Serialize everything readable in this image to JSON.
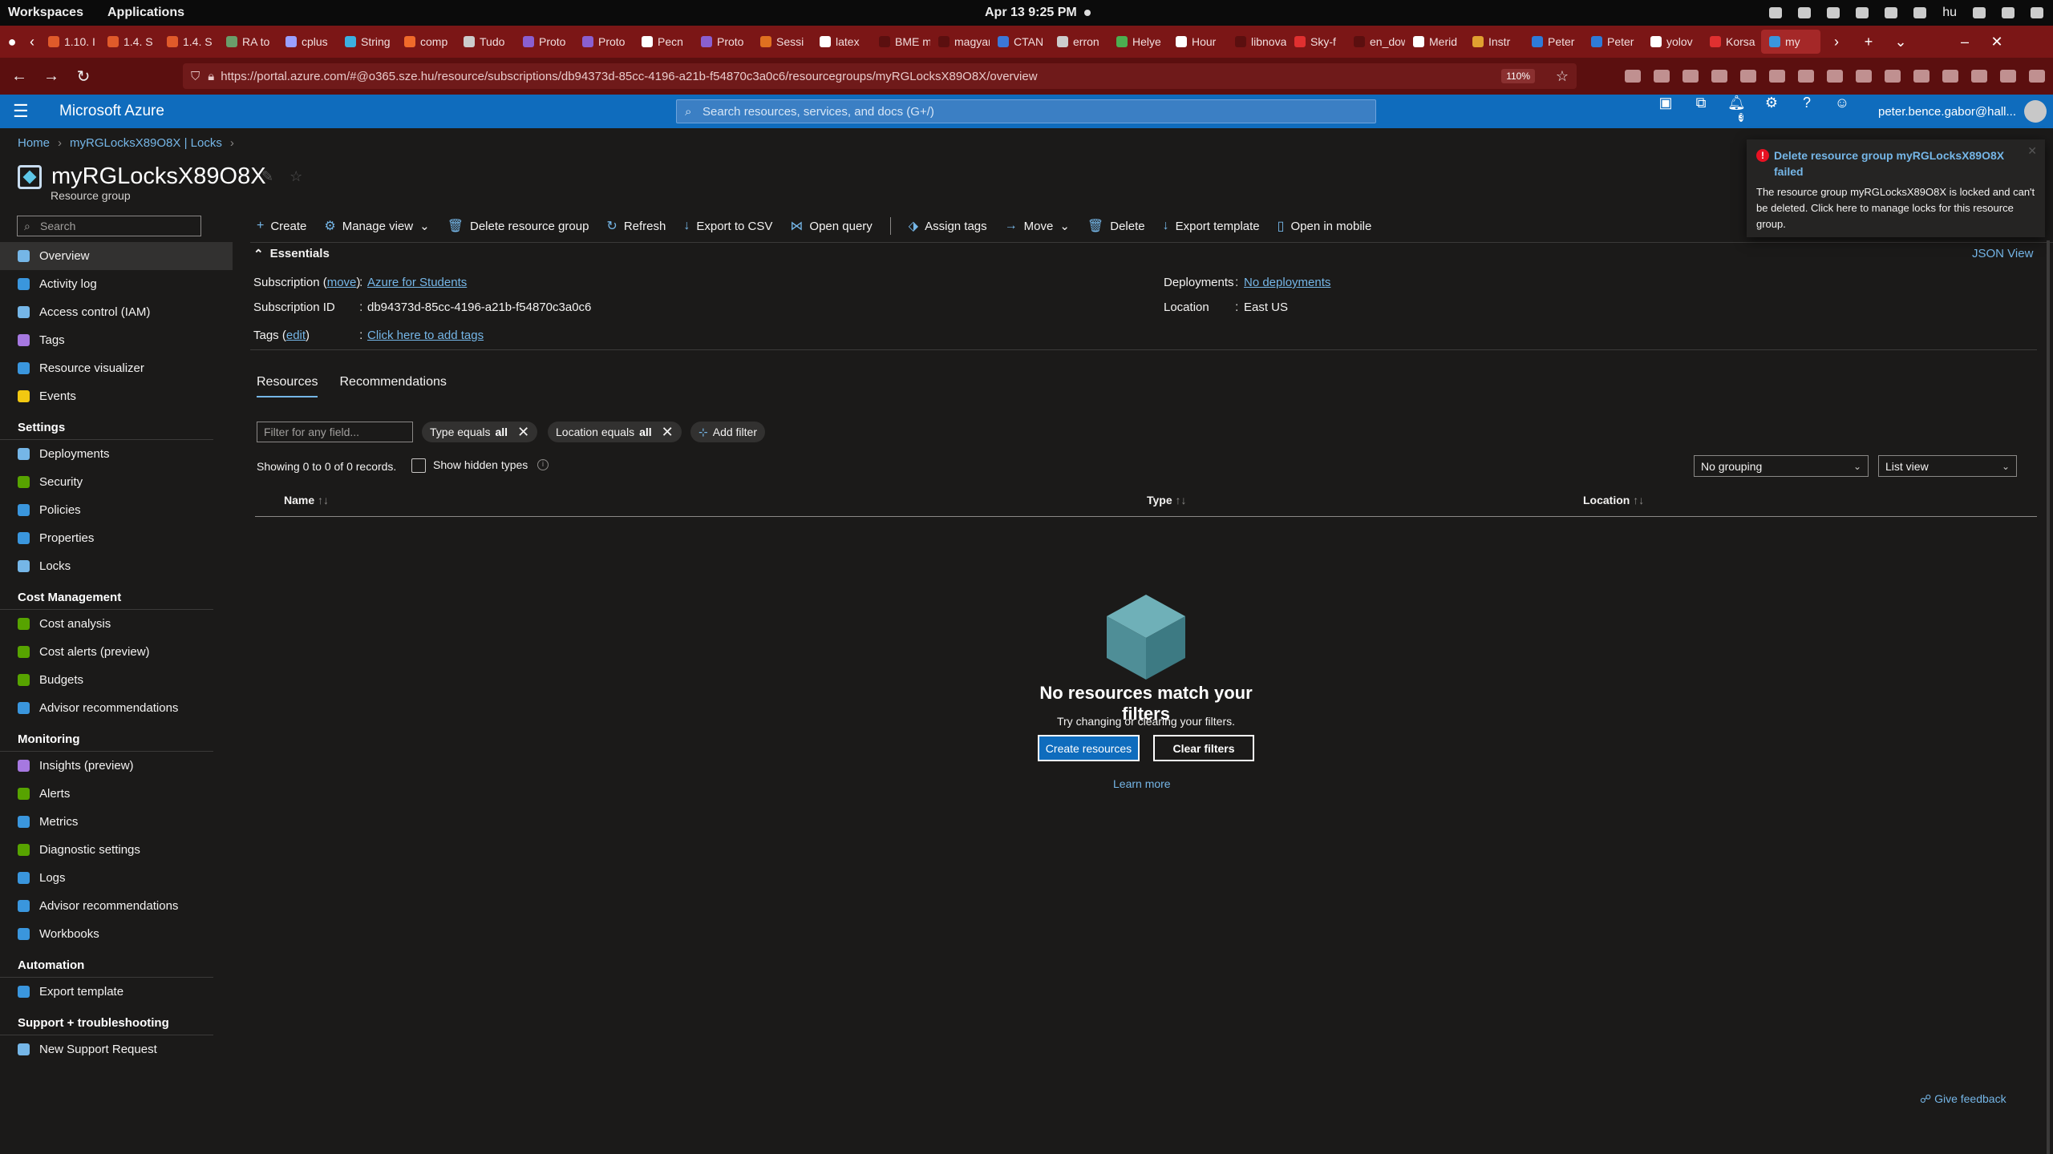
{
  "system": {
    "workspaces": "Workspaces",
    "applications": "Applications",
    "clock": "Apr 13   9:25 PM",
    "lang": "hu"
  },
  "browser": {
    "tabs": [
      {
        "label": "1.10. I",
        "color": "#e05a2a"
      },
      {
        "label": "1.4. S",
        "color": "#e05a2a"
      },
      {
        "label": "1.4. S",
        "color": "#e05a2a"
      },
      {
        "label": "RA to",
        "color": "#6a9e6a"
      },
      {
        "label": "cplus",
        "color": "#9aa0ff"
      },
      {
        "label": "String",
        "color": "#3cb0e0"
      },
      {
        "label": "comp",
        "color": "#f06a2a"
      },
      {
        "label": "Tudo",
        "color": "#cccccc"
      },
      {
        "label": "Proto",
        "color": "#8a5fd0"
      },
      {
        "label": "Proto",
        "color": "#8a5fd0"
      },
      {
        "label": "Pecn",
        "color": "#ffffff"
      },
      {
        "label": "Proto",
        "color": "#8a5fd0"
      },
      {
        "label": "Sessi",
        "color": "#e07020"
      },
      {
        "label": "latex",
        "color": "#ffffff"
      },
      {
        "label": "BME mat",
        "color": "#5b0f0f"
      },
      {
        "label": "magyarc",
        "color": "#5b0f0f"
      },
      {
        "label": "CTAN",
        "color": "#3c78d8"
      },
      {
        "label": "erron",
        "color": "#cccccc"
      },
      {
        "label": "Helye",
        "color": "#4caf50"
      },
      {
        "label": "Hour",
        "color": "#ffffff"
      },
      {
        "label": "libnova.",
        "color": "#5b0f0f"
      },
      {
        "label": "Sky-f",
        "color": "#e03030"
      },
      {
        "label": "en_dow",
        "color": "#5b0f0f"
      },
      {
        "label": "Merid",
        "color": "#ffffff"
      },
      {
        "label": "Instr",
        "color": "#e0a030"
      },
      {
        "label": "Peter",
        "color": "#2f7bd8"
      },
      {
        "label": "Peter",
        "color": "#2f7bd8"
      },
      {
        "label": "yolov",
        "color": "#ffffff"
      },
      {
        "label": "Korsa",
        "color": "#e03030"
      },
      {
        "label": "my",
        "color": "#3a96dd"
      }
    ],
    "url": "https://portal.azure.com/#@o365.sze.hu/resource/subscriptions/db94373d-85cc-4196-a21b-f54870c3a0c6/resourcegroups/myRGLocksX89O8X/overview",
    "zoom": "110%"
  },
  "azure": {
    "brand": "Microsoft Azure",
    "search_placeholder": "Search resources, services, and docs (G+/)",
    "notif_count": "3",
    "user": "peter.bence.gabor@hall..."
  },
  "breadcrumb": [
    "Home",
    "myRGLocksX89O8X | Locks"
  ],
  "resource": {
    "name": "myRGLocksX89O8X",
    "type": "Resource group"
  },
  "sidebar": {
    "search_placeholder": "Search",
    "top": [
      {
        "label": "Overview",
        "icon": "overview-icon",
        "color": "#75b6e7",
        "active": true
      },
      {
        "label": "Activity log",
        "icon": "activity-log-icon",
        "color": "#3a96dd"
      },
      {
        "label": "Access control (IAM)",
        "icon": "iam-icon",
        "color": "#75b6e7"
      },
      {
        "label": "Tags",
        "icon": "tag-icon",
        "color": "#a678e0"
      },
      {
        "label": "Resource visualizer",
        "icon": "visualizer-icon",
        "color": "#3a96dd"
      },
      {
        "label": "Events",
        "icon": "lightning-icon",
        "color": "#f2c811"
      }
    ],
    "sections": [
      {
        "title": "Settings",
        "items": [
          {
            "label": "Deployments",
            "icon": "deployments-icon",
            "color": "#75b6e7"
          },
          {
            "label": "Security",
            "icon": "shield-icon",
            "color": "#57a300"
          },
          {
            "label": "Policies",
            "icon": "policies-icon",
            "color": "#3a96dd"
          },
          {
            "label": "Properties",
            "icon": "properties-icon",
            "color": "#3a96dd"
          },
          {
            "label": "Locks",
            "icon": "lock-icon",
            "color": "#75b6e7"
          }
        ]
      },
      {
        "title": "Cost Management",
        "items": [
          {
            "label": "Cost analysis",
            "icon": "cost-analysis-icon",
            "color": "#57a300"
          },
          {
            "label": "Cost alerts (preview)",
            "icon": "cost-alerts-icon",
            "color": "#57a300"
          },
          {
            "label": "Budgets",
            "icon": "budgets-icon",
            "color": "#57a300"
          },
          {
            "label": "Advisor recommendations",
            "icon": "advisor-icon",
            "color": "#3a96dd"
          }
        ]
      },
      {
        "title": "Monitoring",
        "items": [
          {
            "label": "Insights (preview)",
            "icon": "insights-icon",
            "color": "#a678e0"
          },
          {
            "label": "Alerts",
            "icon": "alerts-icon",
            "color": "#57a300"
          },
          {
            "label": "Metrics",
            "icon": "metrics-icon",
            "color": "#3a96dd"
          },
          {
            "label": "Diagnostic settings",
            "icon": "diagnostic-icon",
            "color": "#57a300"
          },
          {
            "label": "Logs",
            "icon": "logs-icon",
            "color": "#3a96dd"
          },
          {
            "label": "Advisor recommendations",
            "icon": "advisor-icon",
            "color": "#3a96dd"
          },
          {
            "label": "Workbooks",
            "icon": "workbooks-icon",
            "color": "#3a96dd"
          }
        ]
      },
      {
        "title": "Automation",
        "items": [
          {
            "label": "Export template",
            "icon": "export-template-icon",
            "color": "#3a96dd"
          }
        ]
      },
      {
        "title": "Support + troubleshooting",
        "items": [
          {
            "label": "New Support Request",
            "icon": "support-icon",
            "color": "#75b6e7"
          }
        ]
      }
    ]
  },
  "commands": {
    "create": "Create",
    "manage_view": "Manage view",
    "delete_group": "Delete resource group",
    "refresh": "Refresh",
    "export_csv": "Export to CSV",
    "open_query": "Open query",
    "assign_tags": "Assign tags",
    "move": "Move",
    "delete": "Delete",
    "export_template": "Export template",
    "open_mobile": "Open in mobile"
  },
  "essentials": {
    "title": "Essentials",
    "json_view": "JSON View",
    "subscription_label": "Subscription",
    "move_link": "move",
    "subscription_value": "Azure for Students",
    "subscription_id_label": "Subscription ID",
    "subscription_id_value": "db94373d-85cc-4196-a21b-f54870c3a0c6",
    "tags_label": "Tags",
    "edit_link": "edit",
    "tags_value": "Click here to add tags",
    "deployments_label": "Deployments",
    "deployments_value": "No deployments",
    "location_label": "Location",
    "location_value": "East US"
  },
  "tabs": [
    "Resources",
    "Recommendations"
  ],
  "filters": {
    "placeholder": "Filter for any field...",
    "type_pill": "Type equals",
    "type_value": "all",
    "location_pill": "Location equals",
    "location_value": "all",
    "add_filter": "Add filter",
    "showing": "Showing 0 to 0 of 0 records.",
    "show_hidden": "Show hidden types",
    "grouping": "No grouping",
    "view": "List view"
  },
  "table": {
    "columns": [
      "Name",
      "Type",
      "Location"
    ]
  },
  "empty": {
    "title": "No resources match your filters",
    "subtitle": "Try changing or clearing your filters.",
    "create": "Create resources",
    "clear": "Clear filters",
    "learn": "Learn more"
  },
  "feedback": "Give feedback",
  "toast": {
    "title": "Delete resource group myRGLocksX89O8X failed",
    "body": "The resource group myRGLocksX89O8X is locked and can't be deleted. Click here to manage locks for this resource group."
  }
}
